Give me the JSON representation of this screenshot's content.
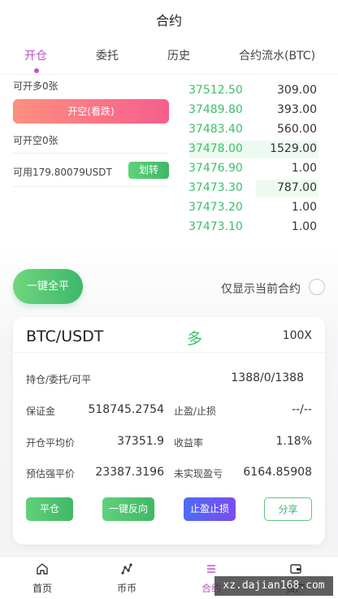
{
  "header": {
    "title": "合约"
  },
  "tabs": [
    {
      "label": "开仓",
      "active": true
    },
    {
      "label": "委托",
      "active": false
    },
    {
      "label": "历史",
      "active": false
    },
    {
      "label": "合约流水(BTC)",
      "active": false
    }
  ],
  "trade": {
    "can_open_long": "可开多0张",
    "open_short_button": "开空(看跌)",
    "can_open_short": "可开空0张",
    "available": "可用179.80079USDT",
    "transfer_button": "划转"
  },
  "orderbook": [
    {
      "price": "37512.50",
      "qty": "309.00",
      "depth": 0
    },
    {
      "price": "37489.80",
      "qty": "393.00",
      "depth": 0
    },
    {
      "price": "37483.40",
      "qty": "560.00",
      "depth": 0
    },
    {
      "price": "37478.00",
      "qty": "1529.00",
      "depth": 1.0
    },
    {
      "price": "37476.90",
      "qty": "1.00",
      "depth": 0
    },
    {
      "price": "37473.30",
      "qty": "787.00",
      "depth": 0.48
    },
    {
      "price": "37473.20",
      "qty": "1.00",
      "depth": 0
    },
    {
      "price": "37473.10",
      "qty": "1.00",
      "depth": 0
    }
  ],
  "actions": {
    "close_all": "一键全平",
    "only_current": "仅显示当前合约"
  },
  "position": {
    "pair": "BTC/USDT",
    "side": "多",
    "leverage": "100X",
    "hold_label": "持仓/委托/可平",
    "hold_value": "1388/0/1388",
    "margin_label": "保证金",
    "margin_value": "518745.2754",
    "tpsl_label": "止盈/止损",
    "tpsl_value": "--/--",
    "avg_price_label": "开仓平均价",
    "avg_price_value": "37351.9",
    "yield_label": "收益率",
    "yield_value": "1.18%",
    "liq_label": "预估强平价",
    "liq_value": "23387.3196",
    "unrealized_label": "未实现盈亏",
    "unrealized_value": "6164.85908",
    "btn_close": "平仓",
    "btn_reverse": "一键反向",
    "btn_tpsl": "止盈止损",
    "btn_share": "分享"
  },
  "nav": [
    {
      "label": "首页",
      "icon": "home-icon",
      "active": false
    },
    {
      "label": "币币",
      "icon": "chart-icon",
      "active": false
    },
    {
      "label": "合约",
      "icon": "contract-icon",
      "active": true
    },
    {
      "label": "资产",
      "icon": "wallet-icon",
      "active": false
    }
  ],
  "watermark": "xz.dajian168.com",
  "colors": {
    "accent": "#c451d1",
    "up_green": "#3cc06b",
    "short_red": "#f55e8d",
    "blue": "#4e6cf2"
  }
}
